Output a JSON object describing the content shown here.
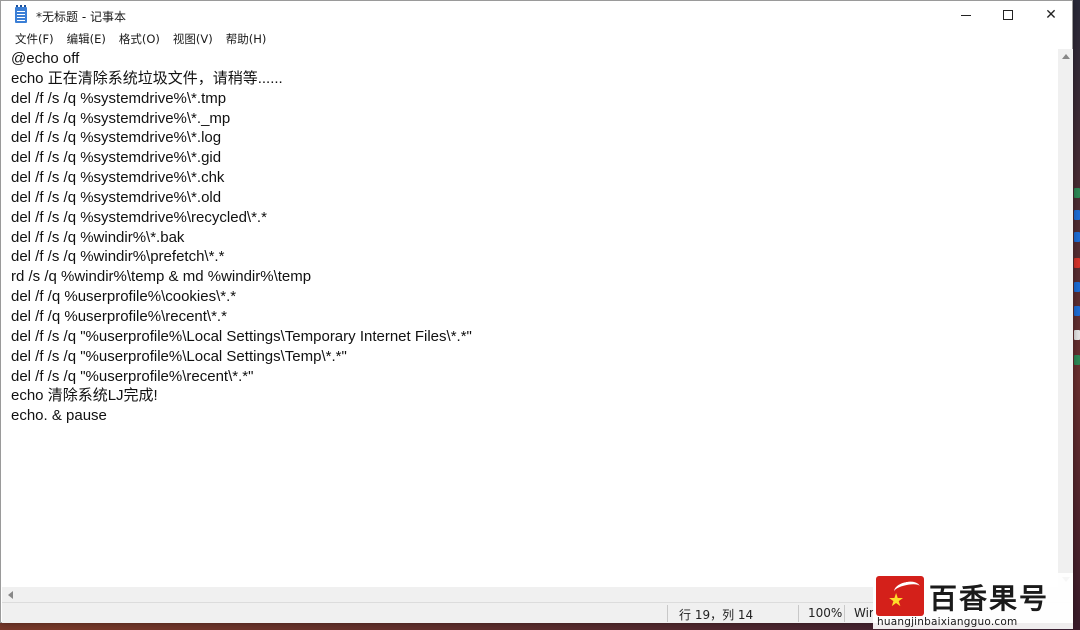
{
  "window": {
    "title": "*无标题 - 记事本",
    "controls": {
      "minimize": "minimize",
      "maximize": "maximize",
      "close": "✕"
    }
  },
  "menu": {
    "items": [
      "文件(F)",
      "编辑(E)",
      "格式(O)",
      "视图(V)",
      "帮助(H)"
    ]
  },
  "editor": {
    "lines": [
      "@echo off",
      "echo 正在清除系统垃圾文件，请稍等......",
      "del /f /s /q %systemdrive%\\*.tmp",
      "del /f /s /q %systemdrive%\\*._mp",
      "del /f /s /q %systemdrive%\\*.log",
      "del /f /s /q %systemdrive%\\*.gid",
      "del /f /s /q %systemdrive%\\*.chk",
      "del /f /s /q %systemdrive%\\*.old",
      "del /f /s /q %systemdrive%\\recycled\\*.*",
      "del /f /s /q %windir%\\*.bak",
      "del /f /s /q %windir%\\prefetch\\*.*",
      "rd /s /q %windir%\\temp & md %windir%\\temp",
      "del /f /q %userprofile%\\cookies\\*.*",
      "del /f /q %userprofile%\\recent\\*.*",
      "del /f /s /q \"%userprofile%\\Local Settings\\Temporary Internet Files\\*.*\"",
      "del /f /s /q \"%userprofile%\\Local Settings\\Temp\\*.*\"",
      "del /f /s /q \"%userprofile%\\recent\\*.*\"",
      "echo 清除系统LJ完成!",
      "echo. & pause"
    ]
  },
  "statusbar": {
    "position": "行 19，列 14",
    "zoom": "100%",
    "line_ending": "Wir"
  },
  "watermark": {
    "title": "百香果号",
    "url": "huangjinbaixiangguo.com"
  },
  "colors": {
    "accent": "#3b7fd6",
    "watermark_red": "#d4201a",
    "watermark_star": "#ffde2a"
  }
}
